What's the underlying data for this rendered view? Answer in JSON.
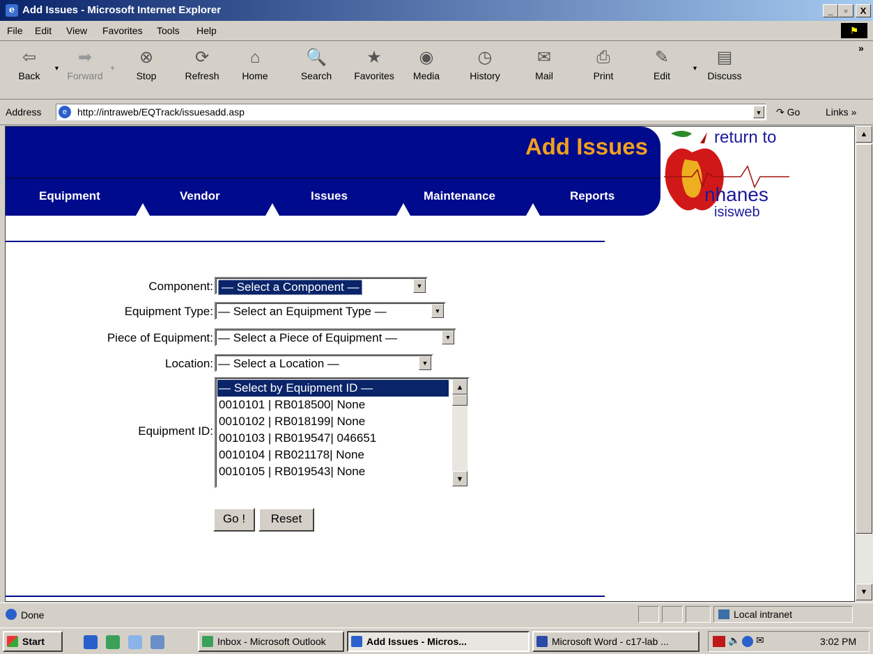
{
  "window": {
    "title": "Add Issues - Microsoft Internet Explorer",
    "minimize": "_",
    "maximize": "▫",
    "close": "X"
  },
  "menu": [
    "File",
    "Edit",
    "View",
    "Favorites",
    "Tools",
    "Help"
  ],
  "toolbar": {
    "back": "Back",
    "forward": "Forward",
    "stop": "Stop",
    "refresh": "Refresh",
    "home": "Home",
    "search": "Search",
    "favorites": "Favorites",
    "media": "Media",
    "history": "History",
    "mail": "Mail",
    "print": "Print",
    "edit": "Edit",
    "discuss": "Discuss",
    "more": "»"
  },
  "address": {
    "label": "Address",
    "url": "http://intraweb/EQTrack/issuesadd.asp",
    "go": "Go",
    "links": "Links »"
  },
  "page": {
    "title": "Add Issues",
    "nav": [
      "Equipment",
      "Vendor",
      "Issues",
      "Maintenance",
      "Reports"
    ],
    "logo": {
      "line1": "return to",
      "line2": "nhanes",
      "line3": "isisweb"
    }
  },
  "form": {
    "component_label": "Component:",
    "component_value": "— Select a Component —",
    "equipment_type_label": "Equipment Type:",
    "equipment_type_value": "— Select an Equipment Type —",
    "piece_label": "Piece of Equipment:",
    "piece_value": "— Select a Piece of Equipment —",
    "location_label": "Location:",
    "location_value": "— Select a Location —",
    "equipment_id_label": "Equipment ID:",
    "equipment_id_options": [
      "— Select by Equipment ID —",
      "0010101 | RB018500| None",
      "0010102 | RB018199| None",
      "0010103 | RB019547| 046651",
      "0010104 | RB021178| None",
      "0010105 | RB019543| None"
    ],
    "go_button": "Go !",
    "reset_button": "Reset"
  },
  "status": {
    "text": "Done",
    "zone": "Local intranet"
  },
  "taskbar": {
    "start": "Start",
    "tasks": [
      "Inbox - Microsoft Outlook",
      "Add Issues - Micros...",
      "Microsoft Word - c17-lab ..."
    ],
    "clock": "3:02 PM"
  },
  "colors": {
    "banner": "#000a8c",
    "title_accent": "#f0a020",
    "selection": "#0a246a"
  }
}
